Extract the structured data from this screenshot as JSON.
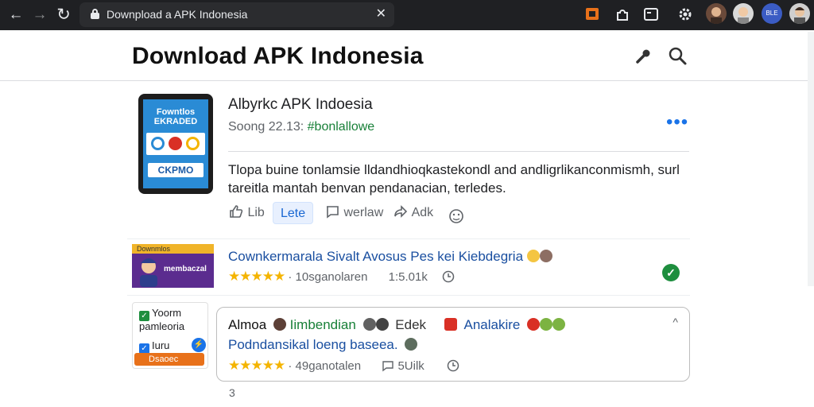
{
  "browser": {
    "url": "Downpload a APK Indonesia",
    "back_glyph": "←",
    "forward_glyph": "→",
    "reload_glyph": "↻",
    "close_glyph": "✕",
    "profile_label": "BLE"
  },
  "header": {
    "title": "Download APK Indonesia"
  },
  "app": {
    "name": "Albyrkc APK Indoesia",
    "meta_prefix": "Soong 22.13:",
    "meta_tag": "#bonlallowe",
    "more": "•••",
    "description": "Tlopa buine tonlamsie lldandhioqkastekondl and andligrlikanconmismh, surl tareitla mantah benvan pendanacian, terledes.",
    "screen_text_top": "Fowntlos EKRADED",
    "screen_text_bottom": "CKPMO",
    "actions": {
      "like": "Lib",
      "active": "Lete",
      "comment": "werlaw",
      "share": "Adk"
    }
  },
  "row1": {
    "banner_top": "Downmlos",
    "banner_label": "membaczal",
    "title": "Cownkermarala Sivalt Avosus Pes kei Kiebdegria",
    "stars": "★★★★★",
    "rating_count": "· 10sganolaren",
    "size": "1:5.01k"
  },
  "side": {
    "item1": "Yoorm",
    "item2": "pamleoria",
    "item3": "Iuru",
    "button": "Dsaoec"
  },
  "comment": {
    "author": "Almoa",
    "tag1": "Iimbendian",
    "tag2": "Edek",
    "tag3": "Analakire",
    "line2": "Podndansikal loeng baseea.",
    "stars": "★★★★★",
    "rating_count": "· 49ganotalen",
    "size": "5Uilk",
    "caret": "^"
  },
  "footer_mark": "3"
}
